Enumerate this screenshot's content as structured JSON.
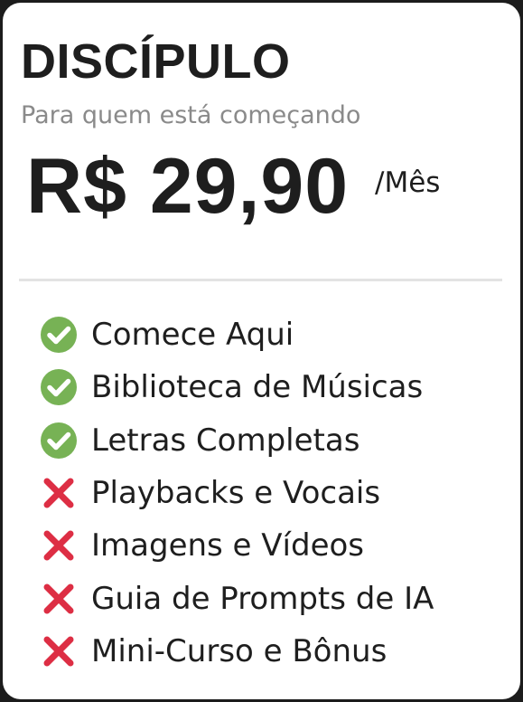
{
  "plan": {
    "name": "DISCÍPULO",
    "subtitle": "Para quem está começando",
    "price": "R$ 29,90",
    "period": "/Mês"
  },
  "colors": {
    "included": "#77b255",
    "excluded": "#dd2e44",
    "card_background": "#ffffff",
    "page_background": "#1c1c1c"
  },
  "features": [
    {
      "label": "Comece Aqui",
      "included": true,
      "icon": "check-icon"
    },
    {
      "label": "Biblioteca de Músicas",
      "included": true,
      "icon": "check-icon"
    },
    {
      "label": "Letras Completas",
      "included": true,
      "icon": "check-icon"
    },
    {
      "label": "Playbacks e Vocais",
      "included": false,
      "icon": "cross-icon"
    },
    {
      "label": "Imagens e Vídeos",
      "included": false,
      "icon": "cross-icon"
    },
    {
      "label": "Guia de Prompts de IA",
      "included": false,
      "icon": "cross-icon"
    },
    {
      "label": "Mini-Curso e Bônus",
      "included": false,
      "icon": "cross-icon"
    }
  ]
}
